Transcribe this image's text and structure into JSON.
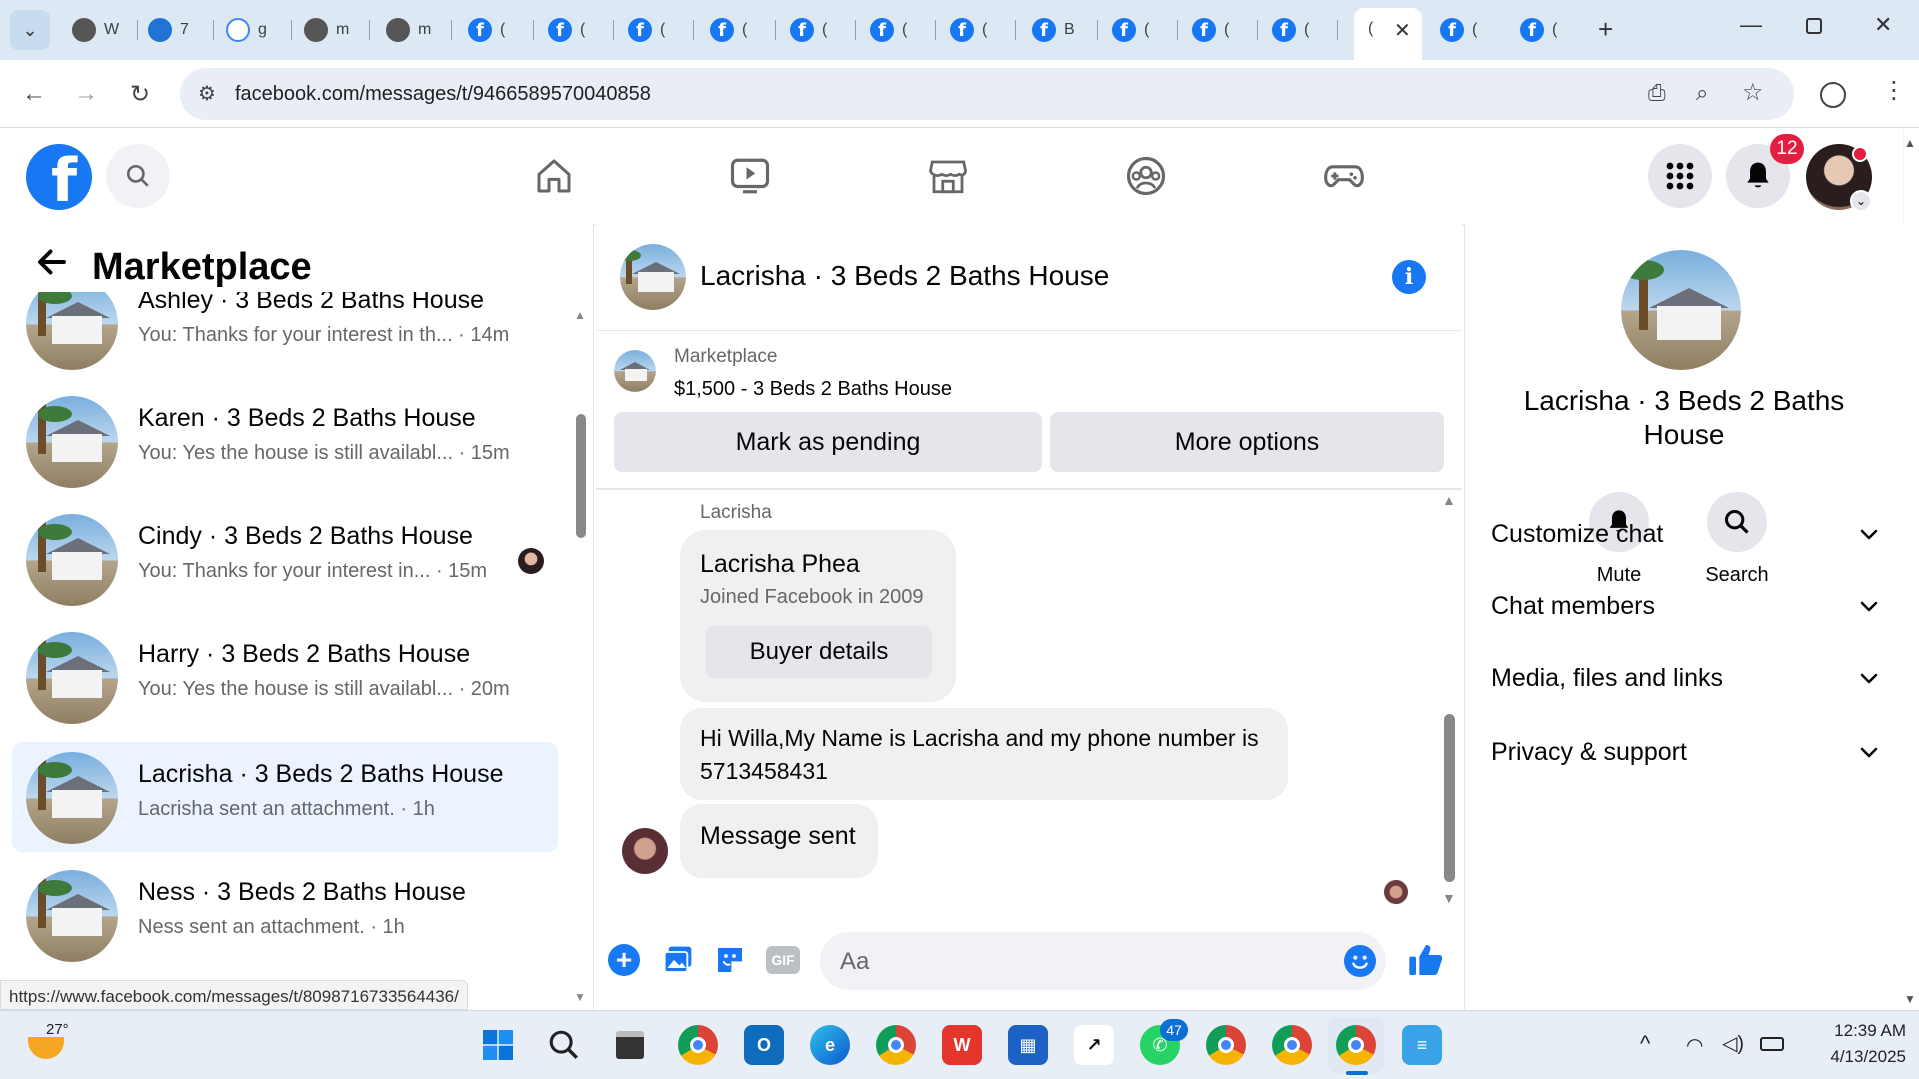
{
  "browser": {
    "tabs": [
      {
        "label": "W",
        "icon": "chrome-icon"
      },
      {
        "label": "7",
        "icon": "azure-icon"
      },
      {
        "label": "g",
        "icon": "google-icon"
      },
      {
        "label": "m",
        "icon": "globe-icon"
      },
      {
        "label": "m",
        "icon": "globe-icon"
      },
      {
        "label": "(",
        "icon": "facebook-icon"
      },
      {
        "label": "(",
        "icon": "facebook-icon"
      },
      {
        "label": "(",
        "icon": "facebook-icon"
      },
      {
        "label": "(",
        "icon": "facebook-icon"
      },
      {
        "label": "(",
        "icon": "facebook-icon"
      },
      {
        "label": "(",
        "icon": "facebook-icon"
      },
      {
        "label": "(",
        "icon": "facebook-icon"
      },
      {
        "label": "B",
        "icon": "facebook-icon"
      },
      {
        "label": "(",
        "icon": "facebook-icon"
      },
      {
        "label": "(",
        "icon": "facebook-icon"
      },
      {
        "label": "(",
        "icon": "facebook-icon"
      }
    ],
    "active_tab_label": "(",
    "tabs_after": [
      {
        "label": "(",
        "icon": "facebook-icon"
      },
      {
        "label": "(",
        "icon": "facebook-icon"
      }
    ],
    "url": "facebook.com/messages/t/9466589570040858",
    "status_url": "https://www.facebook.com/messages/t/8098716733564436/"
  },
  "fb": {
    "notification_count": "12"
  },
  "left": {
    "title": "Marketplace",
    "conversations": [
      {
        "name": "Ashley · 3 Beds 2 Baths House",
        "message": "You: Thanks for your interest in th... · 14m"
      },
      {
        "name": "Karen · 3 Beds 2 Baths House",
        "message": "You: Yes the house is still availabl... · 15m"
      },
      {
        "name": "Cindy · 3 Beds 2 Baths House",
        "message": "You: Thanks for your interest in... · 15m"
      },
      {
        "name": "Harry · 3 Beds 2 Baths House",
        "message": "You: Yes the house is still availabl... · 20m"
      },
      {
        "name": "Lacrisha · 3 Beds 2 Baths House",
        "message": "Lacrisha sent an attachment. · 1h"
      },
      {
        "name": "Ness · 3 Beds 2 Baths House",
        "message": "Ness sent an attachment. · 1h"
      }
    ]
  },
  "chat": {
    "title": "Lacrisha · 3 Beds 2 Baths House",
    "listing_source": "Marketplace",
    "listing_title": "$1,500 - 3 Beds 2 Baths House",
    "mark_pending_label": "Mark as pending",
    "more_options_label": "More options",
    "sender_label": "Lacrisha",
    "profile_name": "Lacrisha Phea",
    "profile_joined": "Joined Facebook in 2009",
    "buyer_details_label": "Buyer details",
    "message_1": "Hi Willa,My Name is Lacrisha and my phone number is 5713458431",
    "message_2": "Message sent",
    "input_placeholder": "Aa"
  },
  "right": {
    "title": "Lacrisha · 3 Beds 2 Baths House",
    "mute_label": "Mute",
    "search_label": "Search",
    "sections": [
      "Customize chat",
      "Chat members",
      "Media, files and links",
      "Privacy & support"
    ]
  },
  "taskbar": {
    "weather_temp": "27°",
    "whatsapp_count": "47",
    "time": "12:39 AM",
    "date": "4/13/2025"
  },
  "colors": {
    "fb_blue": "#1877f2",
    "active_conv_bg": "#ebf3fe",
    "badge_red": "#e41e3f"
  }
}
